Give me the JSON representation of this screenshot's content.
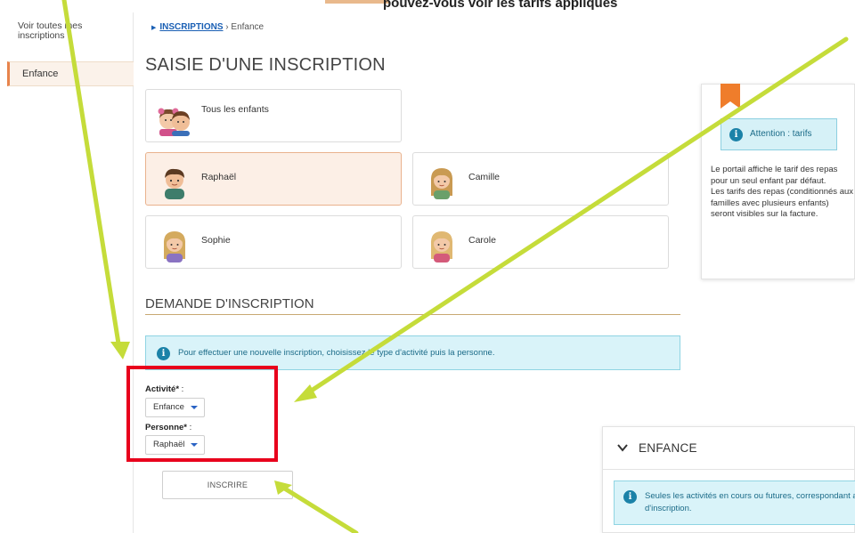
{
  "sidebar": {
    "link_all": "Voir toutes mes inscriptions",
    "active_item": "Enfance"
  },
  "top_fragment": "pouvez-vous voir les tarifs appliqués",
  "breadcrumb": {
    "root": "INSCRIPTIONS",
    "separator": "›",
    "current": "Enfance"
  },
  "page_title": "SAISIE D'UNE INSCRIPTION",
  "children": {
    "all": "Tous les enfants",
    "items": [
      "Raphaël",
      "Camille",
      "Sophie",
      "Carole"
    ],
    "selected": "Raphaël"
  },
  "info_panel": {
    "attention": "Attention : tarifs",
    "text_1": "Le portail affiche le tarif des repas pour un seul enfant par défaut.",
    "text_2": "Les tarifs des repas (conditionnés aux familles avec plusieurs enfants) seront visibles sur la facture."
  },
  "section_title": "DEMANDE D'INSCRIPTION",
  "info_banner": "Pour effectuer une nouvelle inscription, choisissez le type d'activité puis la personne.",
  "form": {
    "activity_label": "Activité*",
    "activity_value": "Enfance",
    "person_label": "Personne*",
    "person_value": "Raphaël",
    "colon": " :",
    "submit": "INSCRIRE"
  },
  "enfance_panel": {
    "title": "ENFANCE",
    "alert": "Seules les activités en cours ou futures, correspondant au formulaire d'inscription."
  },
  "colors": {
    "accent": "#e8844c",
    "annotation_arrow": "#c5dc3a",
    "highlight_box": "#e8001c",
    "info_blue": "#1b82a8"
  }
}
